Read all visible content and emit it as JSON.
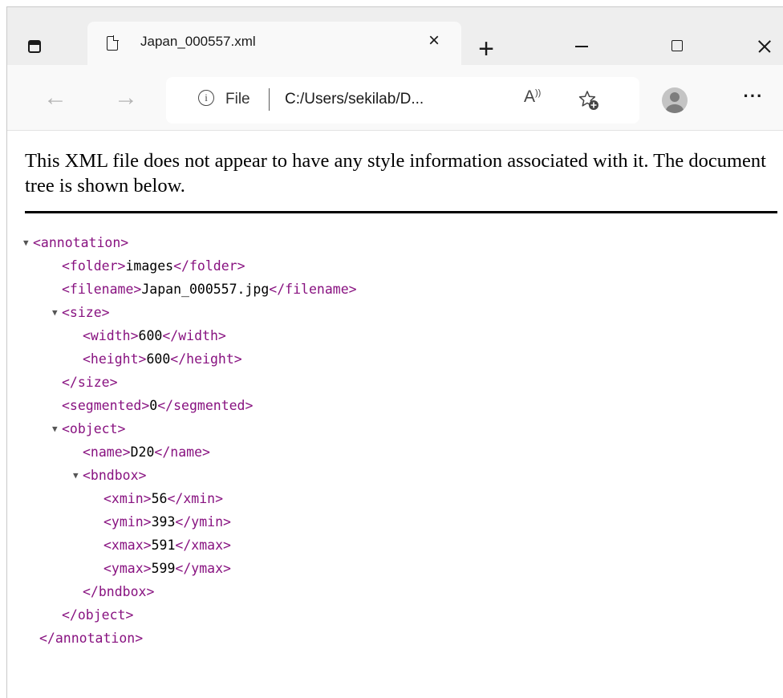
{
  "browser": {
    "tab": {
      "title": "Japan_000557.xml",
      "close": "×"
    },
    "new_tab": "+",
    "address": {
      "scheme_label": "File",
      "url": "C:/Users/sekilab/D...",
      "info_glyph": "i",
      "read_aloud_glyph": "A",
      "read_aloud_sup": "))"
    },
    "back_glyph": "←",
    "forward_glyph": "→",
    "more_glyph": "···"
  },
  "page": {
    "message": "This XML file does not appear to have any style information associated with it. The document tree is shown below.",
    "toggle_glyph": "▼",
    "tree": {
      "annotation_open": "<annotation>",
      "folder_open": "<folder>",
      "folder_value": "images",
      "folder_close": "</folder>",
      "filename_open": "<filename>",
      "filename_value": "Japan_000557.jpg",
      "filename_close": "</filename>",
      "size_open": "<size>",
      "width_open": "<width>",
      "width_value": "600",
      "width_close": "</width>",
      "height_open": "<height>",
      "height_value": "600",
      "height_close": "</height>",
      "size_close": "</size>",
      "segmented_open": "<segmented>",
      "segmented_value": "0",
      "segmented_close": "</segmented>",
      "object_open": "<object>",
      "name_open": "<name>",
      "name_value": "D20",
      "name_close": "</name>",
      "bndbox_open": "<bndbox>",
      "xmin_open": "<xmin>",
      "xmin_value": "56",
      "xmin_close": "</xmin>",
      "ymin_open": "<ymin>",
      "ymin_value": "393",
      "ymin_close": "</ymin>",
      "xmax_open": "<xmax>",
      "xmax_value": "591",
      "xmax_close": "</xmax>",
      "ymax_open": "<ymax>",
      "ymax_value": "599",
      "ymax_close": "</ymax>",
      "bndbox_close": "</bndbox>",
      "object_close": "</object>",
      "annotation_close": "</annotation>"
    }
  },
  "colors": {
    "tag": "#881280",
    "tabbar": "#eeeeee",
    "toolbar": "#f9f9f9"
  }
}
